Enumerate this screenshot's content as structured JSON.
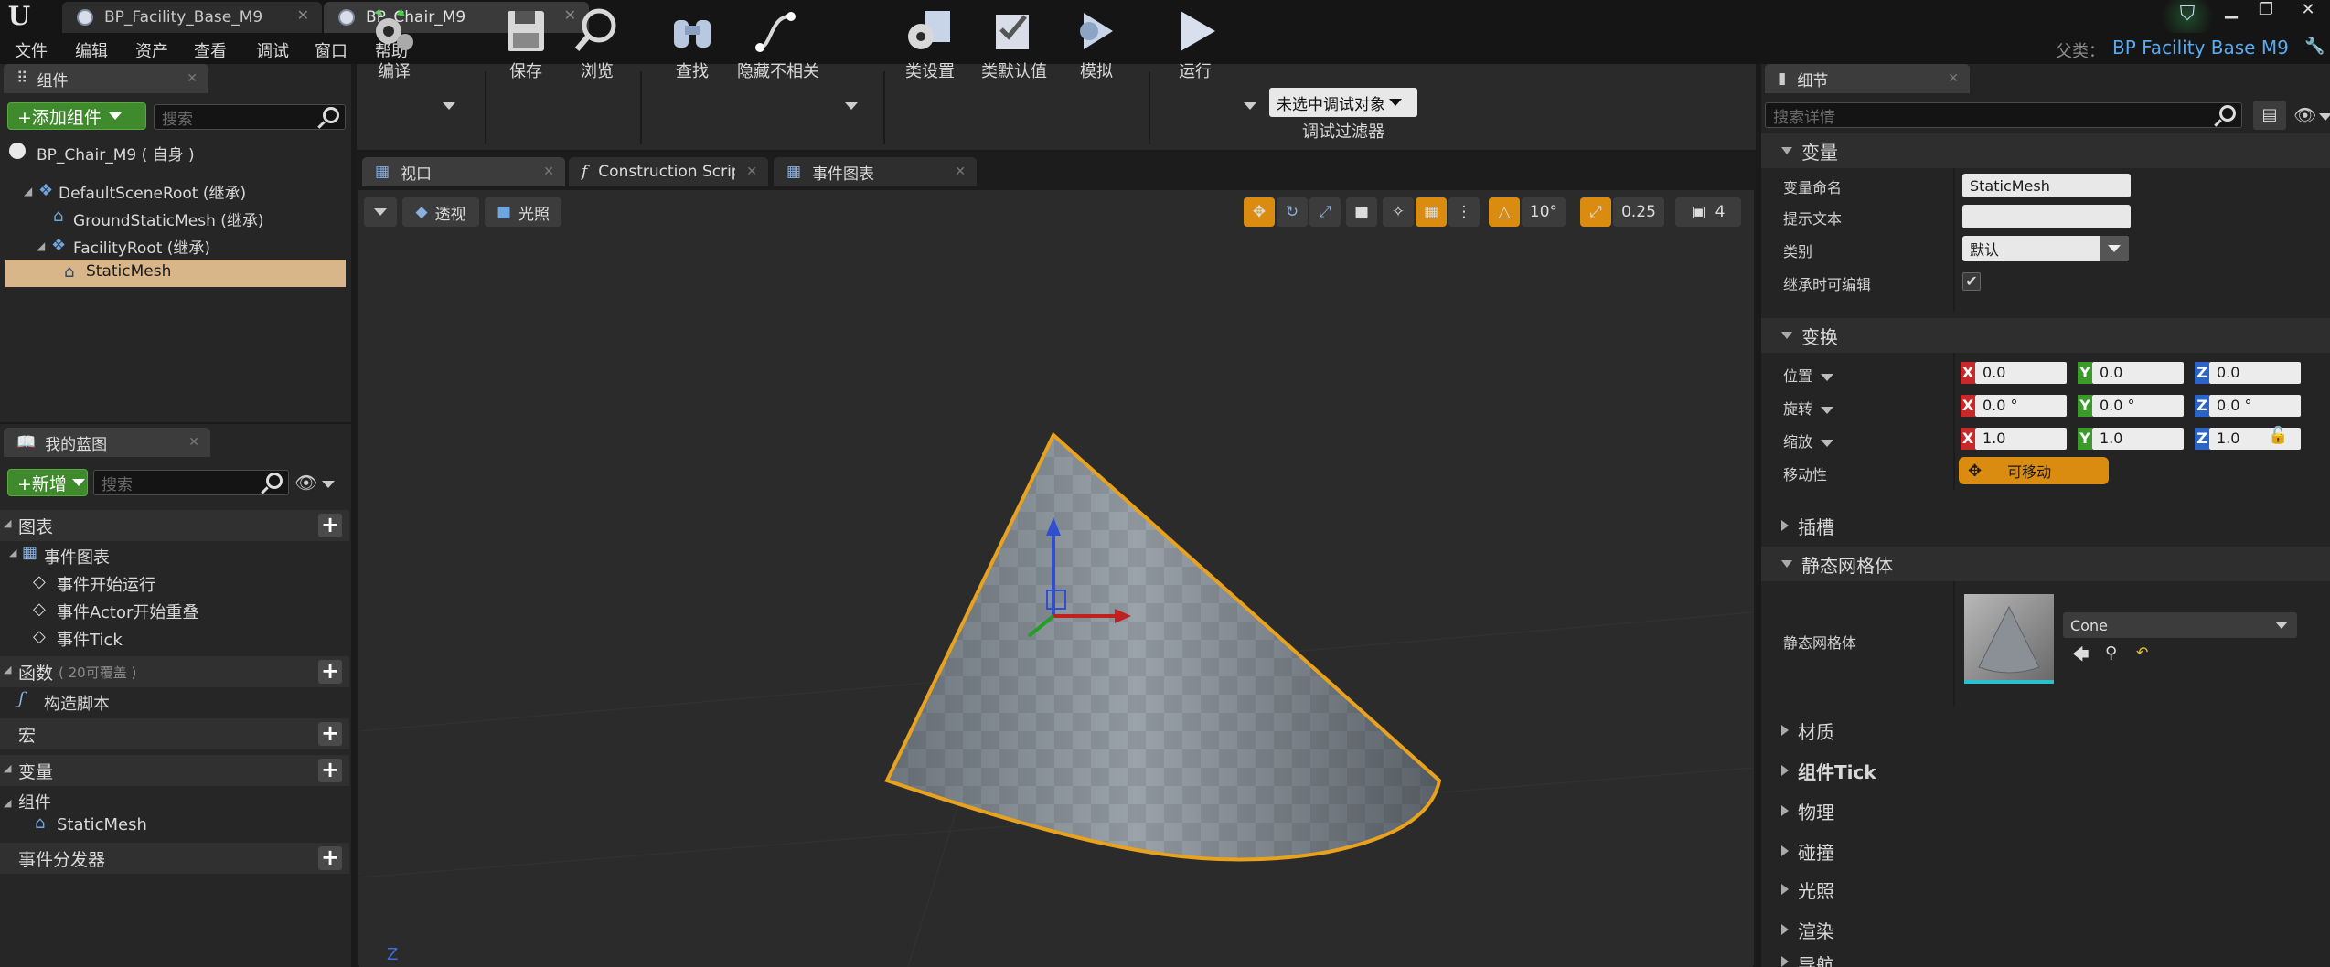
{
  "tabs": [
    {
      "label": "BP_Facility_Base_M9"
    },
    {
      "label": "BP_Chair_M9"
    }
  ],
  "menu": [
    "文件",
    "编辑",
    "资产",
    "查看",
    "调试",
    "窗口",
    "帮助"
  ],
  "parent": {
    "label": "父类：",
    "value": "BP Facility Base M9"
  },
  "components_panel": {
    "tab": "组件",
    "add_button": "+添加组件",
    "search_placeholder": "搜索",
    "root_item": "BP_Chair_M9 ( 自身 )",
    "items": [
      {
        "label": "DefaultSceneRoot (继承)"
      },
      {
        "label": "GroundStaticMesh (继承)"
      },
      {
        "label": "FacilityRoot (继承)"
      },
      {
        "label": "StaticMesh"
      }
    ]
  },
  "blueprint_panel": {
    "tab": "我的蓝图",
    "new_button": "+新增",
    "search_placeholder": "搜索",
    "graphs_section": "图表",
    "event_graph": "事件图表",
    "events": [
      "事件开始运行",
      "事件Actor开始重叠",
      "事件Tick"
    ],
    "functions_section": "函数",
    "functions_hint": "( 20可覆盖 )",
    "construction_script": "构造脚本",
    "macros_section": "宏",
    "variables_section": "变量",
    "components_sub": "组件",
    "component_var": "StaticMesh",
    "dispatchers_section": "事件分发器"
  },
  "toolbar": {
    "compile": "编译",
    "save": "保存",
    "browse": "浏览",
    "find": "查找",
    "hide_unrelated": "隐藏不相关",
    "class_settings": "类设置",
    "class_defaults": "类默认值",
    "simulate": "模拟",
    "run": "运行",
    "debug_select": "未选中调试对象",
    "debug_filter": "调试过滤器"
  },
  "editor_tabs": [
    {
      "label": "视口"
    },
    {
      "label": "Construction Script"
    },
    {
      "label": "事件图表"
    }
  ],
  "viewport": {
    "perspective": "透视",
    "lighting": "光照",
    "rotation_snap": "10°",
    "scale_snap": "0.25",
    "camera_speed": "4",
    "axis_label": "Z"
  },
  "details": {
    "tab": "细节",
    "search_placeholder": "搜索详情",
    "variable_section": "变量",
    "var_name_label": "变量命名",
    "var_name_value": "StaticMesh",
    "tooltip_label": "提示文本",
    "tooltip_value": "",
    "category_label": "类别",
    "category_value": "默认",
    "editable_label": "继承时可编辑",
    "transform_section": "变换",
    "location_label": "位置",
    "rotation_label": "旋转",
    "scale_label": "缩放",
    "location": [
      "0.0",
      "0.0",
      "0.0"
    ],
    "rotation": [
      "0.0 °",
      "0.0 °",
      "0.0 °"
    ],
    "scale": [
      "1.0",
      "1.0",
      "1.0"
    ],
    "mobility_label": "移动性",
    "mobility_value": "可移动",
    "sockets_section": "插槽",
    "static_mesh_section": "静态网格体",
    "static_mesh_label": "静态网格体",
    "static_mesh_value": "Cone",
    "collapsed": [
      {
        "label": "材质"
      },
      {
        "label": "组件Tick"
      },
      {
        "label": "物理"
      },
      {
        "label": "碰撞"
      },
      {
        "label": "光照"
      },
      {
        "label": "渲染"
      },
      {
        "label": "导航"
      }
    ]
  },
  "colors": {
    "accent_green": "#3e8a2c",
    "selection": "#d9b68a",
    "orange": "#d98c0f",
    "link_blue": "#5aaaf0"
  }
}
